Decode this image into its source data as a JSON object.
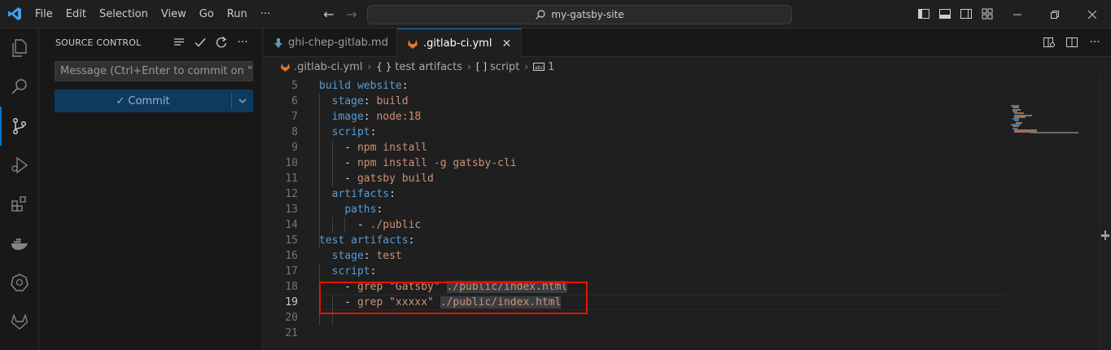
{
  "menu": [
    "File",
    "Edit",
    "Selection",
    "View",
    "Go",
    "Run",
    "···"
  ],
  "command_center": {
    "text": "my-gatsby-site"
  },
  "sidebar": {
    "title": "SOURCE CONTROL",
    "commit_placeholder": "Message (Ctrl+Enter to commit on \"m...",
    "commit_label": "Commit"
  },
  "tabs": [
    {
      "label": "ghi-chep-gitlab.md",
      "icon": "markdown-icon",
      "active": false
    },
    {
      "label": ".gitlab-ci.yml",
      "icon": "gitlab-icon",
      "active": true
    }
  ],
  "breadcrumb": {
    "file": ".gitlab-ci.yml",
    "job": "test artifacts",
    "key": "script",
    "item": "1"
  },
  "code_lines": [
    {
      "n": "5",
      "tokens": [
        [
          "k",
          "build website"
        ],
        [
          "p",
          ":"
        ]
      ]
    },
    {
      "n": "6",
      "tokens": [
        [
          "p",
          "  "
        ],
        [
          "k",
          "stage"
        ],
        [
          "p",
          ": "
        ],
        [
          "v",
          "build"
        ]
      ]
    },
    {
      "n": "7",
      "tokens": [
        [
          "p",
          "  "
        ],
        [
          "k",
          "image"
        ],
        [
          "p",
          ": "
        ],
        [
          "v",
          "node:18"
        ]
      ]
    },
    {
      "n": "8",
      "tokens": [
        [
          "p",
          "  "
        ],
        [
          "k",
          "script"
        ],
        [
          "p",
          ":"
        ]
      ]
    },
    {
      "n": "9",
      "tokens": [
        [
          "p",
          "    - "
        ],
        [
          "v",
          "npm install"
        ]
      ]
    },
    {
      "n": "10",
      "tokens": [
        [
          "p",
          "    - "
        ],
        [
          "v",
          "npm install -g gatsby-cli"
        ]
      ]
    },
    {
      "n": "11",
      "tokens": [
        [
          "p",
          "    - "
        ],
        [
          "v",
          "gatsby build"
        ]
      ]
    },
    {
      "n": "12",
      "tokens": [
        [
          "p",
          "  "
        ],
        [
          "k",
          "artifacts"
        ],
        [
          "p",
          ":"
        ]
      ]
    },
    {
      "n": "13",
      "tokens": [
        [
          "p",
          "    "
        ],
        [
          "k",
          "paths"
        ],
        [
          "p",
          ":"
        ]
      ]
    },
    {
      "n": "14",
      "tokens": [
        [
          "p",
          "      - "
        ],
        [
          "v",
          "./public"
        ]
      ]
    },
    {
      "n": "15",
      "tokens": [
        [
          "k",
          "test artifacts"
        ],
        [
          "p",
          ":"
        ]
      ]
    },
    {
      "n": "16",
      "tokens": [
        [
          "p",
          "  "
        ],
        [
          "k",
          "stage"
        ],
        [
          "p",
          ": "
        ],
        [
          "v",
          "test"
        ]
      ]
    },
    {
      "n": "17",
      "tokens": [
        [
          "p",
          "  "
        ],
        [
          "k",
          "script"
        ],
        [
          "p",
          ":"
        ]
      ]
    },
    {
      "n": "18",
      "tokens": [
        [
          "p",
          "    - "
        ],
        [
          "v",
          "grep \"Gatsby\" "
        ],
        [
          "vs",
          "./public/index.html"
        ]
      ]
    },
    {
      "n": "19",
      "tokens": [
        [
          "p",
          "    - "
        ],
        [
          "v",
          "grep \"xxxxx\" "
        ],
        [
          "vs",
          "./public/index.html"
        ]
      ],
      "current": true
    },
    {
      "n": "20",
      "tokens": []
    },
    {
      "n": "21",
      "tokens": []
    }
  ],
  "colors": {
    "accent": "#0078d4",
    "highlight_box": "#e51400",
    "keyword": "#569cd6",
    "string": "#ce9178"
  }
}
